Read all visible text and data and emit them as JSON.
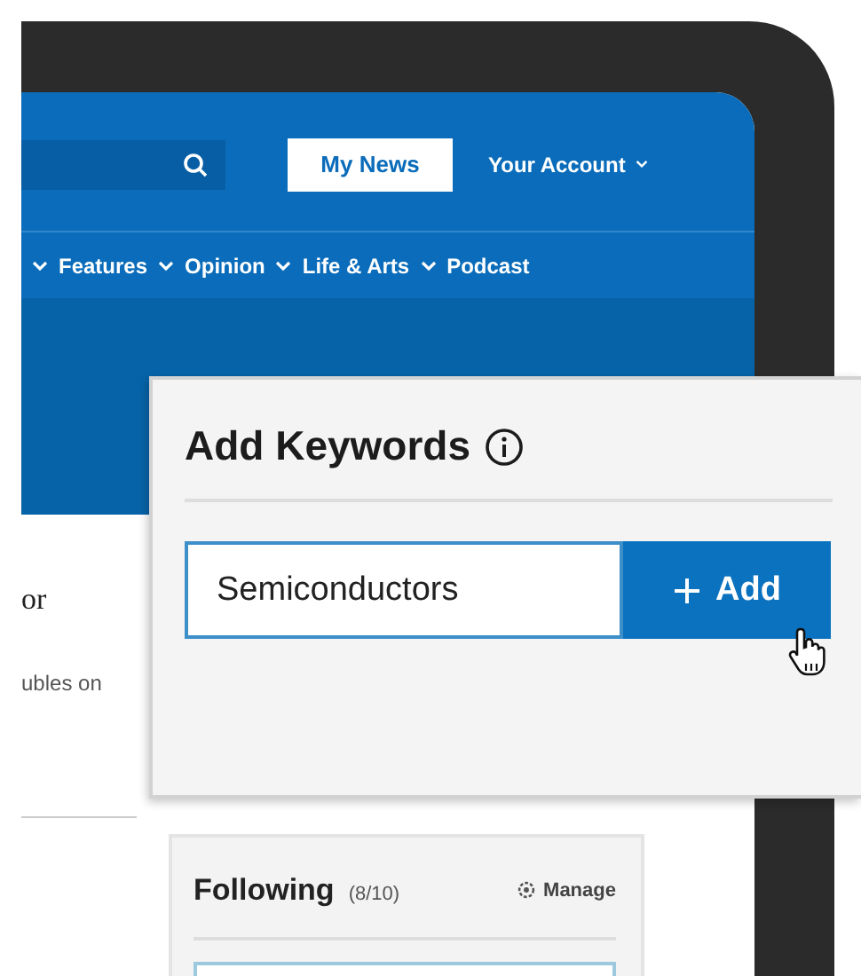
{
  "header": {
    "my_news_button": {
      "label": "My News",
      "selected": true
    },
    "account_menu": "Your Account"
  },
  "nav": [
    {
      "label": "Features",
      "has_menu": true
    },
    {
      "label": "Opinion",
      "has_menu": true
    },
    {
      "label": "Life & Arts",
      "has_menu": true
    },
    {
      "label": "Podcast",
      "has_menu": false
    }
  ],
  "article": {
    "title": "or",
    "summary": "ubles on"
  },
  "following": {
    "title": "Following",
    "count": "(8/10)",
    "manage": "Manage"
  },
  "dialog": {
    "title": "Add Keywords",
    "input": {
      "value": "Semiconductors",
      "focused": true
    },
    "add_button": "Add"
  }
}
